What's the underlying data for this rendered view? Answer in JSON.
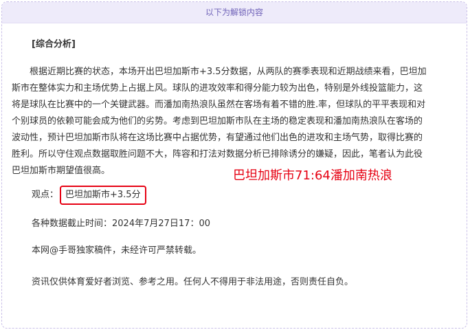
{
  "header": {
    "label": "以下为解锁内容"
  },
  "article": {
    "heading": "[综合分析]",
    "analysis_lines": [
      "　　根据近期比赛的状态，本场开出巴坦加斯市+3.5分数据，从两队的赛季表现和近期战绩来看，巴坦加",
      "斯市在整体实力和主场优势上占据上风。球队的进攻效率和得分能力较为出色，特别是外线投篮能力，这",
      "将是球队在比赛中的一个关键武器。而潘加南热浪队虽然在客场有着不错的胜.率，但球队的平平表现和对",
      "个别球员的依赖可能会成为他们的劣势。考虑到巴坦加斯市队在主场的稳定表现和潘加南热浪队在客场的",
      "波动性，预计巴坦加斯市队将在这场比赛中占据优势，有望通过他们出色的进攻和主场气势，取得比赛的",
      "胜利。所以守住观点数据取胜问题不大，阵容和打法对数据分析已排除诱分的嫌疑，因此，笔者认为此役",
      "巴坦加斯市期望值很高。"
    ],
    "score_annotation": "巴坦加斯市71:64潘加南热浪",
    "view_label": "观点：",
    "view_value": "巴坦加斯市+3.5分",
    "deadline": "各种数据截止时间：2024年7月27日17：00",
    "copyright": "本网@手哥独家稿件，未经许可严禁转载。",
    "disclaimer": "资讯仅供体育爱好者浏览、参考之用。任何人不得用于非法用途，否则责任自负。"
  },
  "colors": {
    "header_bg": "#eeebfa",
    "header_text": "#6f62b8",
    "accent_red": "#e60012",
    "body_text": "#333333"
  }
}
